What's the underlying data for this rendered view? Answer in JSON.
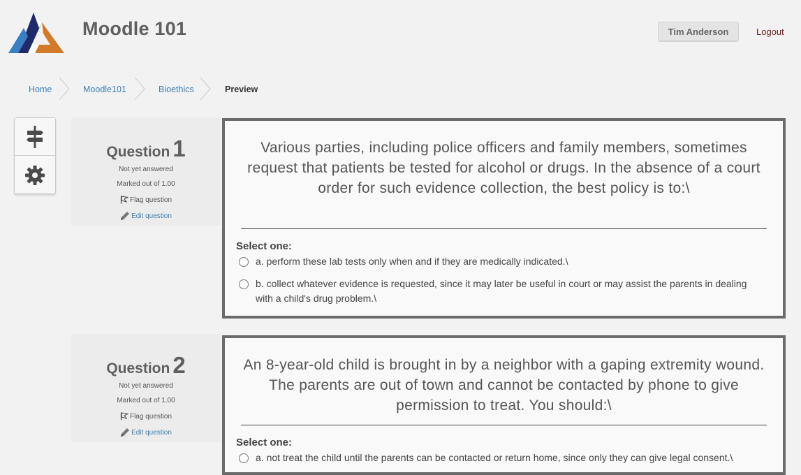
{
  "header": {
    "site_title": "Moodle 101",
    "user_name": "Tim Anderson",
    "logout_label": "Logout"
  },
  "breadcrumb": {
    "items": [
      "Home",
      "Moodle101",
      "Bioethics"
    ],
    "current": "Preview"
  },
  "side_block": {
    "icons": [
      "signpost-icon",
      "gear-icon"
    ]
  },
  "questions": [
    {
      "label": "Question",
      "number": "1",
      "status": "Not yet answered",
      "marks": "Marked out of 1.00",
      "flag_label": "Flag question",
      "edit_label": "Edit question",
      "text": "Various parties, including police officers and family members, sometimes request that patients be tested for alcohol or drugs. In the absence of a court order for such evidence collection, the best policy is to:\\",
      "select_label": "Select one:",
      "answers": [
        "a. perform these lab tests only when and if they are medically indicated.\\",
        "b. collect whatever evidence is requested, since it may later be useful in court or may assist the parents in dealing with a child's drug problem.\\"
      ]
    },
    {
      "label": "Question",
      "number": "2",
      "status": "Not yet answered",
      "marks": "Marked out of 1.00",
      "flag_label": "Flag question",
      "edit_label": "Edit question",
      "text": "An 8-year-old child is brought in by a neighbor with a gaping extremity wound. The parents are out of town and cannot be contacted by phone to give permission to treat. You should:\\",
      "select_label": "Select one:",
      "answers": [
        "a. not treat the child until the parents can be contacted or return home, since only they can give legal consent.\\"
      ]
    }
  ],
  "colors": {
    "link": "#3b7fb5",
    "logout": "#6b1b1b",
    "logo_blue": "#2a3a7a",
    "logo_orange": "#d27a2a",
    "logo_light_blue": "#3a7ec4",
    "border_dark": "#6b6b6b"
  }
}
